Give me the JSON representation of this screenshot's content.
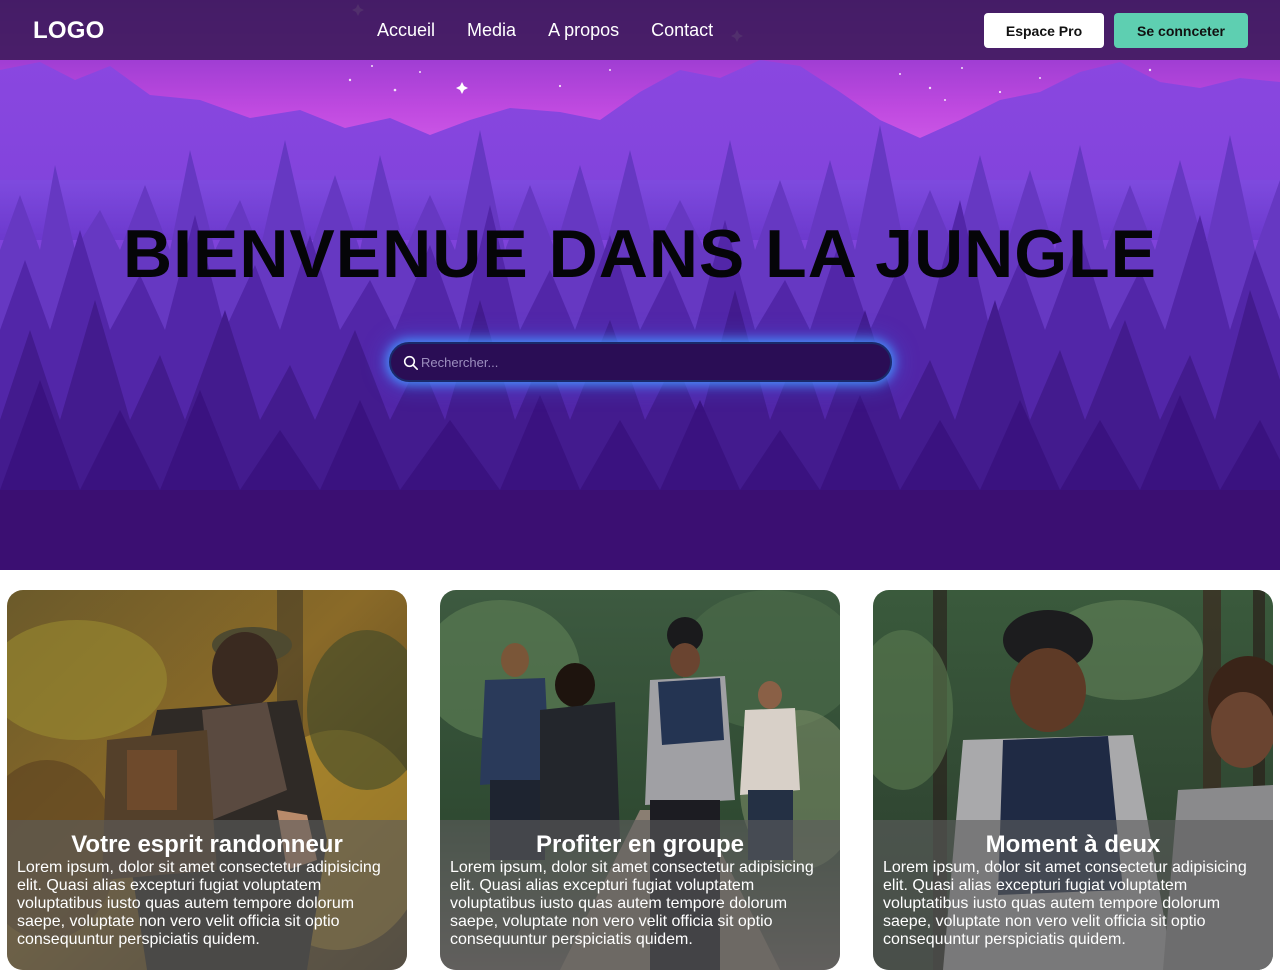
{
  "header": {
    "logo": "LOGO",
    "nav": [
      "Accueil",
      "Media",
      "A propos",
      "Contact"
    ],
    "pro_button": "Espace Pro",
    "login_button": "Se connceter"
  },
  "hero": {
    "title": "BIENVENUE DANS LA JUNGLE",
    "search_placeholder": "Rechercher..."
  },
  "cards": [
    {
      "title": "Votre esprit randonneur",
      "text": "Lorem ipsum, dolor sit amet consectetur adipisicing elit. Quasi alias excepturi fugiat voluptatem voluptatibus iusto quas autem tempore dolorum saepe, voluptate non vero velit officia sit optio consequuntur perspiciatis quidem."
    },
    {
      "title": "Profiter en groupe",
      "text": "Lorem ipsum, dolor sit amet consectetur adipisicing elit. Quasi alias excepturi fugiat voluptatem voluptatibus iusto quas autem tempore dolorum saepe, voluptate non vero velit officia sit optio consequuntur perspiciatis quidem."
    },
    {
      "title": "Moment à deux",
      "text": "Lorem ipsum, dolor sit amet consectetur adipisicing elit. Quasi alias excepturi fugiat voluptatem voluptatibus iusto quas autem tempore dolorum saepe, voluptate non vero velit officia sit optio consequuntur perspiciatis quidem."
    }
  ],
  "colors": {
    "navbar": "#3e1a5a",
    "hero_bg": "#3b0f72",
    "accent_teal": "#5ecfb1",
    "search_glow": "#4696ff"
  },
  "icons": {
    "search": "search-icon"
  }
}
